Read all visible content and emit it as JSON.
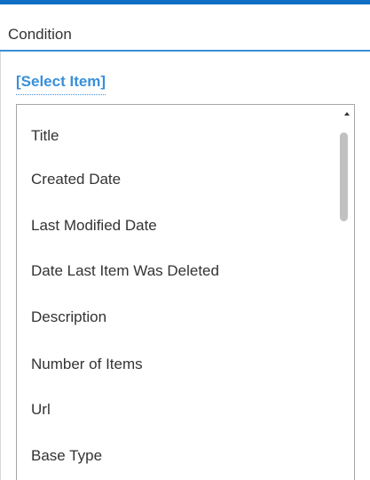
{
  "header": {
    "title": "Condition"
  },
  "select_link": "[Select Item]",
  "list": {
    "items": [
      "Title",
      "Created Date",
      "Last Modified Date",
      "Date Last Item Was Deleted",
      "Description",
      "Number of Items",
      "Url",
      "Base Type"
    ]
  },
  "colors": {
    "accent": "#0f6fc6",
    "link": "#3a8fd9",
    "text": "#333333"
  }
}
